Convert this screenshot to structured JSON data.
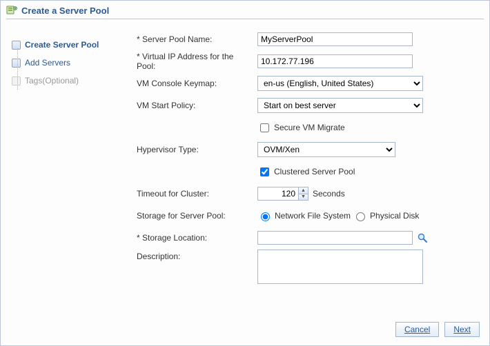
{
  "dialog": {
    "title": "Create a Server Pool"
  },
  "nav": {
    "items": [
      {
        "label": "Create Server Pool",
        "state": "active"
      },
      {
        "label": "Add Servers",
        "state": "enabled"
      },
      {
        "label": "Tags(Optional)",
        "state": "inactive"
      }
    ]
  },
  "form": {
    "serverPoolName": {
      "label": "Server Pool Name:",
      "value": "MyServerPool"
    },
    "virtualIp": {
      "label": "Virtual IP Address for the Pool:",
      "value": "10.172.77.196"
    },
    "keymap": {
      "label": "VM Console Keymap:",
      "value": "en-us (English, United States)"
    },
    "startPolicy": {
      "label": "VM Start Policy:",
      "value": "Start on best server"
    },
    "secureMigrate": {
      "label": "Secure VM Migrate",
      "checked": false
    },
    "hypervisor": {
      "label": "Hypervisor Type:",
      "value": "OVM/Xen"
    },
    "clustered": {
      "label": "Clustered Server Pool",
      "checked": true
    },
    "timeout": {
      "label": "Timeout for Cluster:",
      "value": "120",
      "unit": "Seconds"
    },
    "storage": {
      "label": "Storage for Server Pool:",
      "options": [
        {
          "label": "Network File System",
          "value": "nfs",
          "checked": true
        },
        {
          "label": "Physical Disk",
          "value": "disk",
          "checked": false
        }
      ]
    },
    "storageLocation": {
      "label": "Storage Location:",
      "value": ""
    },
    "description": {
      "label": "Description:",
      "value": ""
    }
  },
  "buttons": {
    "cancel": "Cancel",
    "next": "Next"
  }
}
